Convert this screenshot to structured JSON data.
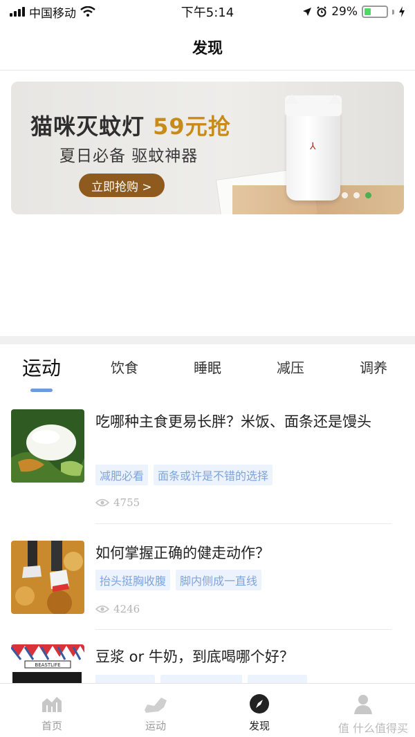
{
  "status_bar": {
    "carrier": "中国移动",
    "time": "下午5:14",
    "battery_pct": "29%",
    "battery_level": 0.29
  },
  "nav": {
    "title": "发现"
  },
  "banner": {
    "title_prefix": "猫咪灭蚊灯",
    "title_price": "59元抢",
    "subtitle": "夏日必备 驱蚊神器",
    "cta": "立即抢购 >",
    "page_count": 3,
    "active_page": 3
  },
  "tabs": [
    "运动",
    "饮食",
    "睡眠",
    "减压",
    "调养"
  ],
  "active_tab": 0,
  "articles": [
    {
      "title": "吃哪种主食更易长胖？米饭、面条还是馒头",
      "tags": [
        "减肥必看",
        "面条或许是不错的选择"
      ],
      "views": "4755"
    },
    {
      "title": "如何掌握正确的健走动作？",
      "tags": [
        "抬头挺胸收腹",
        "脚内侧成一直线"
      ],
      "views": "4246"
    },
    {
      "title": "豆浆 or 牛奶，到底喝哪个好？",
      "tags": [
        "",
        "",
        ""
      ],
      "views": "",
      "thumb_text": "BEASTLIFE"
    }
  ],
  "tabbar": [
    {
      "label": "首页",
      "icon": "chart-icon"
    },
    {
      "label": "运动",
      "icon": "shoe-icon"
    },
    {
      "label": "发现",
      "icon": "compass-icon"
    },
    {
      "label": "",
      "icon": "person-icon"
    }
  ],
  "active_tabbar": 2,
  "watermark": "值 什么值得买",
  "colors": {
    "accent_blue": "#6f9ae0",
    "tag_bg": "#edf3fd",
    "tag_text": "#7fa3dc",
    "cta_brown": "#8f5a1e",
    "price_gold": "#c88b1a"
  }
}
